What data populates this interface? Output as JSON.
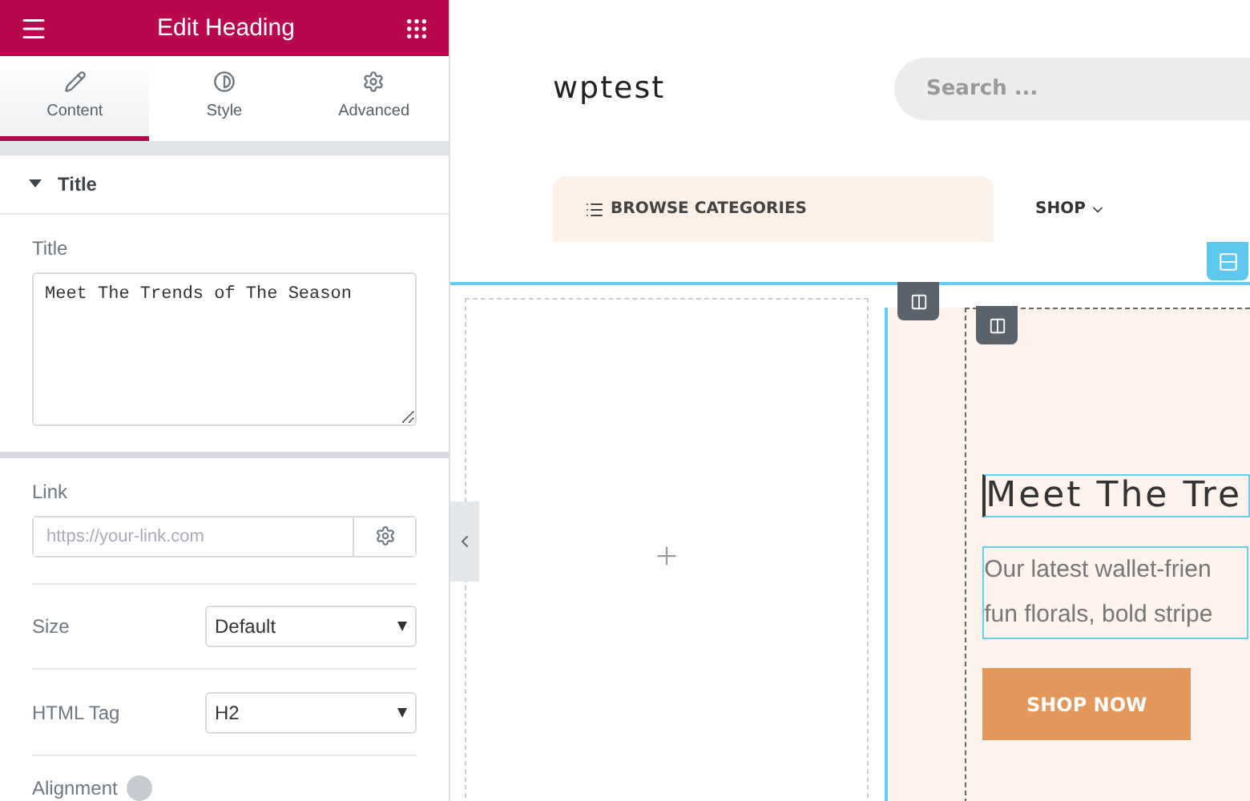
{
  "panel": {
    "title": "Edit Heading",
    "tabs": [
      {
        "label": "Content",
        "selected": true
      },
      {
        "label": "Style",
        "selected": false
      },
      {
        "label": "Advanced",
        "selected": false
      }
    ],
    "section": {
      "title": "Title",
      "expanded": true
    },
    "title_field": {
      "label": "Title",
      "value": "Meet The Trends of The Season"
    },
    "link_field": {
      "label": "Link",
      "placeholder": "https://your-link.com"
    },
    "selects": [
      {
        "label": "Size",
        "value": "Default"
      },
      {
        "label": "HTML Tag",
        "value": "H2"
      }
    ],
    "alignment": {
      "label": "Alignment"
    }
  },
  "site": {
    "logo": "wptest",
    "search": {
      "placeholder": "Search ..."
    },
    "browse": "BROWSE CATEGORIES",
    "menu": [
      {
        "label": "SHOP"
      }
    ]
  },
  "hero": {
    "heading": "Meet The Tre",
    "text": [
      "Our latest wallet-frien",
      "fun florals, bold stripe"
    ],
    "button": "SHOP NOW"
  }
}
